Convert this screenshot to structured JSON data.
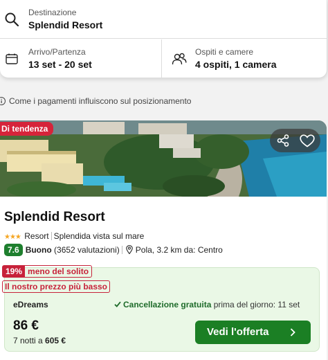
{
  "search": {
    "destination_label": "Destinazione",
    "destination_value": "Splendid Resort",
    "dates_label": "Arrivo/Partenza",
    "dates_value": "13 set - 20 set",
    "guests_label": "Ospiti e camere",
    "guests_value": "4 ospiti, 1 camera"
  },
  "info_text": "Come i pagamenti influiscono sul posizionamento",
  "hotel": {
    "badge": "Di tendenza",
    "name": "Splendid Resort",
    "stars": 3,
    "type": "Resort",
    "feature": "Splendida vista sul mare",
    "score": "7.6",
    "score_label": "Buono",
    "reviews": "(3652 valutazioni)",
    "location": "Pola, 3.2 km da: Centro"
  },
  "deal": {
    "discount_pct": "19%",
    "discount_text": "meno del solito",
    "lowest_price_text": "Il nostro prezzo più basso",
    "provider": "eDreams",
    "cancel_bold": "Cancellazione gratuita",
    "cancel_rest": "prima del giorno: 11 set",
    "price": "86 €",
    "nights_text": "7 notti a",
    "total": "605 €",
    "cta_label": "Vedi l'offerta"
  },
  "colors": {
    "trend_red": "#d6243a",
    "score_green": "#1e7f2e",
    "cta_green": "#1b7f24",
    "offer_bg": "#eaf8e6"
  }
}
